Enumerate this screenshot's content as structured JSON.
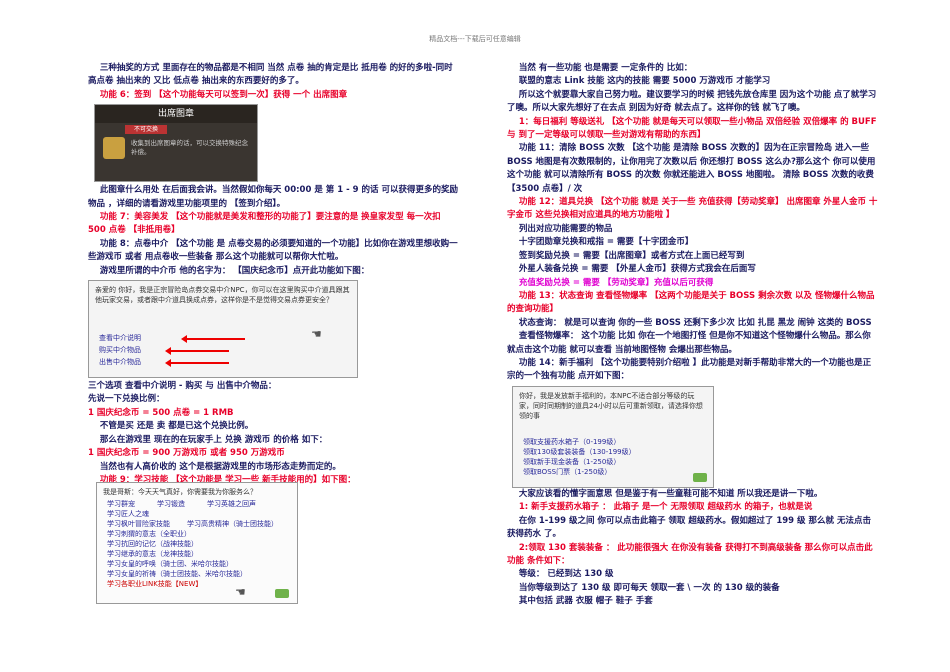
{
  "header": "精品文档---下载后可任意编辑",
  "left": {
    "p1": "三种抽奖的方式 里面存在的物品都是不相同 当然 点卷 抽的肯定是比  抵用卷 的好的多啦-同时 高点卷 抽出来的 又比 低点卷 抽出来的东西要好的多了。",
    "p2": "功能 6：签到 【这个功能每天可以签到一次】获得 一个 出席图章",
    "shot1": {
      "title": "出席图章",
      "tag": "不可交换",
      "desc": "收集到出席图章的话，可以交换特殊纪念补偿。"
    },
    "p3": "此图章什么用处 在后面我会讲。当然假如你每天 00:00 是 第 1 - 9 的话 可以获得更多的奖励物品 ，详细的请看游戏里功能项里的 【签到介绍】。",
    "p4": "功能 7：美容美发 【这个功能就是美发和整形的功能了】要注意的是 换皇家发型 每一次扣 500 点卷 【非抵用卷】",
    "p5": "功能 8：点卷中介 【这个功能 是 点卷交易的必须要知道的一个功能】比如你在游戏里想收购一些游戏币 或者 用点卷收一些装备 那么这个功能就可以帮你大忙啦。",
    "p6": "游戏里所谓的中介币 他的名字为： 【国庆纪念币】点开此功能如下图：",
    "shot2": {
      "text": "亲爱的          你好，我是正宗冒险岛点券交易中介NPC，你可以在这里购买中介道具跟其他玩家交易，或者跟中介道具换成点券，这样你是不是觉得交易点券更安全？",
      "opts": [
        "查看中介说明",
        "购买中介物品",
        "出售中介物品"
      ]
    },
    "p7": "三个选项 查看中介说明 - 购买 与 出售中介物品：",
    "p8": "先说一下兑换比例：",
    "p9": "1 国庆纪念币 = 500 点卷 = 1 RMB",
    "p10": "不管是买 还是 卖 都是已这个兑换比例。",
    "p11": "那么在游戏里 现在的在玩家手上 兑换 游戏币 的价格 如下：",
    "p12": "1 国庆纪念币 = 900 万游戏币 或者 950 万游戏币",
    "p13": "当然也有人高价收的 这个是根据游戏里的市场形态走势而定的。",
    "p14": "功能 9：学习技能 【这个功能是 学习一些 新手技能用的】如下图：",
    "shot3": {
      "text": "我是哥斯：今天天气真好，你需要我为你服务么？",
      "opts": [
        "学习群宠",
        "学习锻造",
        "学习英雄之回声",
        "学习匠人之魂",
        "学习枫叶冒险家技能",
        "学习高贵精神（骑士团技能）",
        "学习刺猬的意志（全职业）",
        "学习抗回的记忆（战神技能）",
        "学习继承的意志（龙神技能）",
        "学习女皇的呼唤（骑士团、米哈尔技能）",
        "学习女皇的祈祷（骑士团技能、米哈尔技能）",
        "学习各职业LINK技能【NEW】"
      ]
    }
  },
  "right": {
    "p1": "当然 有一些功能 也是需要 一定条件的 比如：",
    "p2": "联盟的意志 Link 技能 这内的技能 需要 5000 万游戏币 才能学习",
    "p3": "所以这个就要靠大家自己努力啦。建议要学习的时候 把钱先放仓库里 因为这个功能 点了就学习了噢。所以大家先想好了在去点 别因为好奇 就去点了。这样你的钱 就飞了噢。",
    "p4": "1：每日福利 等级送礼 【这个功能 就是每天可以领取一些小物品 双倍经验 双倍爆率 的 BUFF 与 到了一定等级可以领取一些对游戏有帮助的东西】",
    "p5": "功能 11：清除 BOSS 次数 【这个功能 是清除 BOSS 次数的】因为在正宗冒险岛 进入一些 BOSS 地图是有次数限制的，让你用完了次数以后 你还想打 BOSS 这么办?那么这个 你可以使用这个功能 就可以清除所有 BOSS 的次数 你就还能进入 BOSS 地图啦。 清除 BOSS 次数的收费 【3500 点卷】/ 次",
    "p6": "功能 12：道具兑换 【这个功能 就是 关于一些 充值获得【劳动奖章】 出席图章 外星人金币 十字金币 这些兑换相对应道具的地方功能啦 】",
    "p7": "列出对应功能需要的物品",
    "p8": "十字团勋章兑换和戒指 = 需要【十字团金币】",
    "p9": "签到奖励兑换 = 需要【出席图章】或者方式在上面已经写到",
    "p10": "外星人装备兑换 = 需要 【外星人金币】获得方式我会在后面写",
    "p11": "充值奖励兑换 = 需要 【劳动奖章】充值以后可获得",
    "p12": "功能 13：状态查询 查看怪物爆率 【这两个功能是关于 BOSS 剩余次数 以及 怪物爆什么物品 的查询功能】",
    "p13": "状态查询：  就是可以查询 你的一些 BOSS 还剩下多少次 比如 扎昆 黑龙 闹钟 这类的 BOSS",
    "p14": "查看怪物爆率： 这个功能 比如 你在一个地图打怪 但是你不知道这个怪物爆什么物品。那么你就点击这个功能 就可以查看 当前地图怪物 会爆出那些物品。",
    "p15": "功能 14：新手福利 【这个功能要特别介绍啦 】此功能是对新手帮助非常大的一个功能也是正宗的一个独有功能 点开如下图：",
    "shot4": {
      "text": "你好，我是发放新手福利的，本NPC不适合部分等级的玩家，同时同期制的道具24小时以后可重新领取，请选择你想领的事",
      "opts": [
        "领取支援药水箱子（0-199级）",
        "领取130级套装装备（130-199级）",
        "领取新手现金装备（1-250级）",
        "领取BOSS门票（1-250级）"
      ]
    },
    "p16": "大家应该看的懂字面意思 但是鉴于有一些童鞋可能不知道 所以我还是讲一下啦。",
    "p17": "1: 新手支援药水箱子 ：  此箱子 是一个 无限领取 超级药水 的箱子，也就是说",
    "p18": "在你 1-199 级之间 你可以点击此箱子 领取 超级药水。假如超过了 199 级 那么就 无法点击获得药水 了。",
    "p19": "2:领取 130 套装装备 ：  此功能很强大 在你没有装备 获得打不到高级装备 那么你可以点击此功能 条件如下：",
    "p20": "等级：  已经到达 130 级",
    "p21": "当你等级到达了 130 级 即可每天 领取一套 \\ 一次 的 130 级的装备",
    "p22": "其中包括 武器 衣服 帽子 鞋子 手套"
  }
}
